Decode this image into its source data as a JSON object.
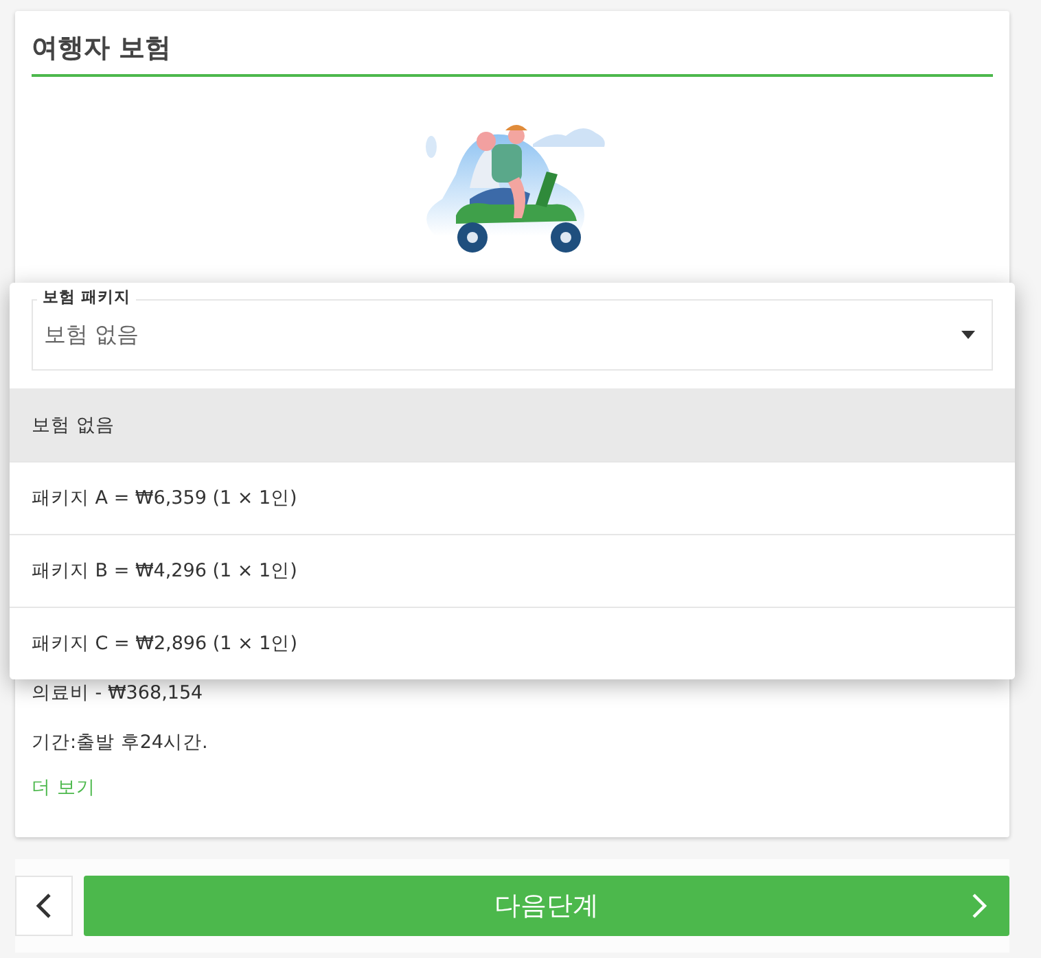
{
  "header": {
    "title": "여행자 보험"
  },
  "package_select": {
    "label": "보험 패키지",
    "value": "보험 없음",
    "expanded": true
  },
  "options": [
    {
      "label": "보험 없음",
      "selected": true
    },
    {
      "label": "패키지 A = ₩6,359 (1 × 1인)",
      "selected": false
    },
    {
      "label": "패키지 B = ₩4,296 (1 × 1인)",
      "selected": false
    },
    {
      "label": "패키지 C = ₩2,896 (1 × 1인)",
      "selected": false
    }
  ],
  "details": [
    "의료비 - ₩368,154",
    "기간:출발 후24시간."
  ],
  "more_link": "더 보기",
  "footer": {
    "next_button": "다음단계"
  }
}
